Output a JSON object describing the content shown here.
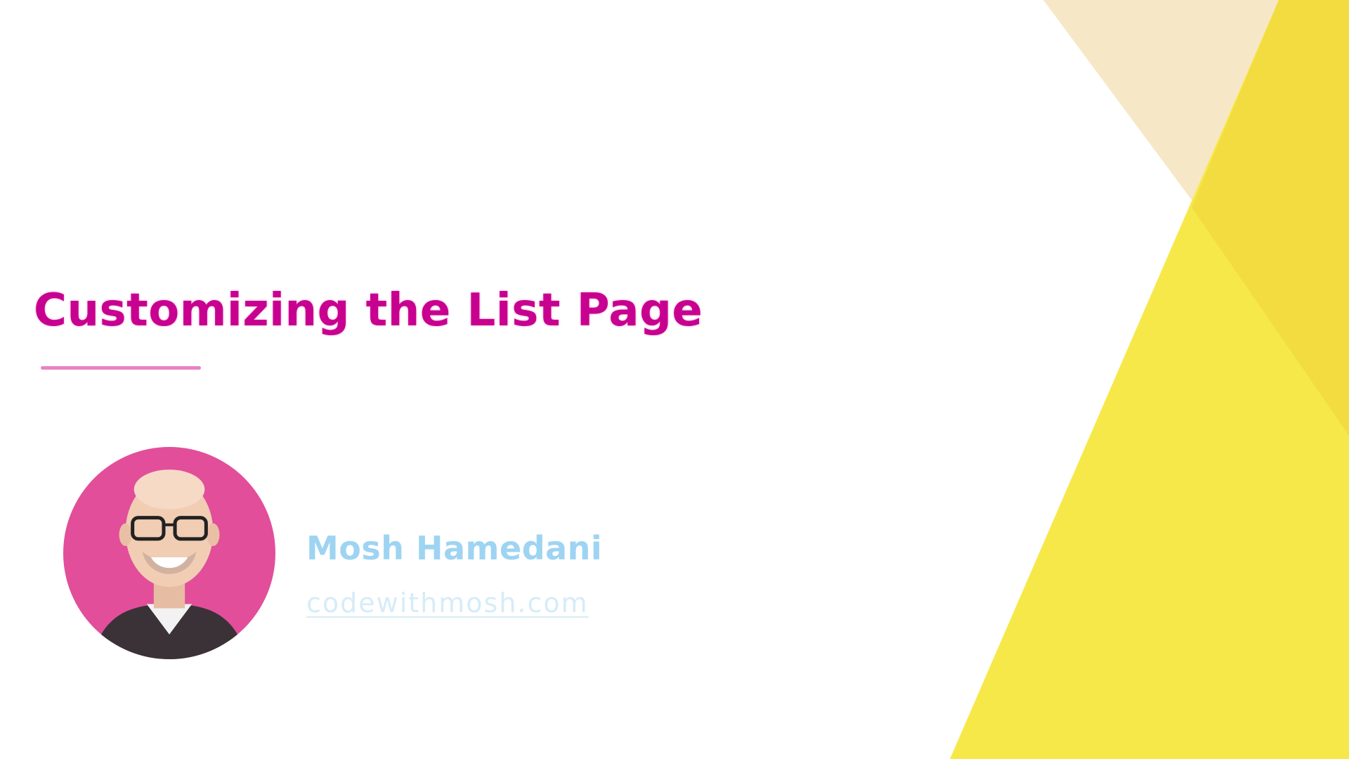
{
  "slide": {
    "title": "Customizing the List Page",
    "author": {
      "name": "Mosh Hamedani",
      "website": "codewithmosh.com"
    }
  },
  "colors": {
    "title": "#c8008f",
    "underline": "#ea82c6",
    "author_name": "#9ed4f2",
    "author_site": "#d6ecf8",
    "yellow_main": "#f7e84a",
    "yellow_dark": "#f3dc40",
    "cream": "#f6e8c6",
    "avatar_bg": "#e24e9a",
    "skin": "#f1cdb4",
    "shirt": "#3a3236"
  },
  "icons": {
    "avatar": "presenter-photo"
  }
}
